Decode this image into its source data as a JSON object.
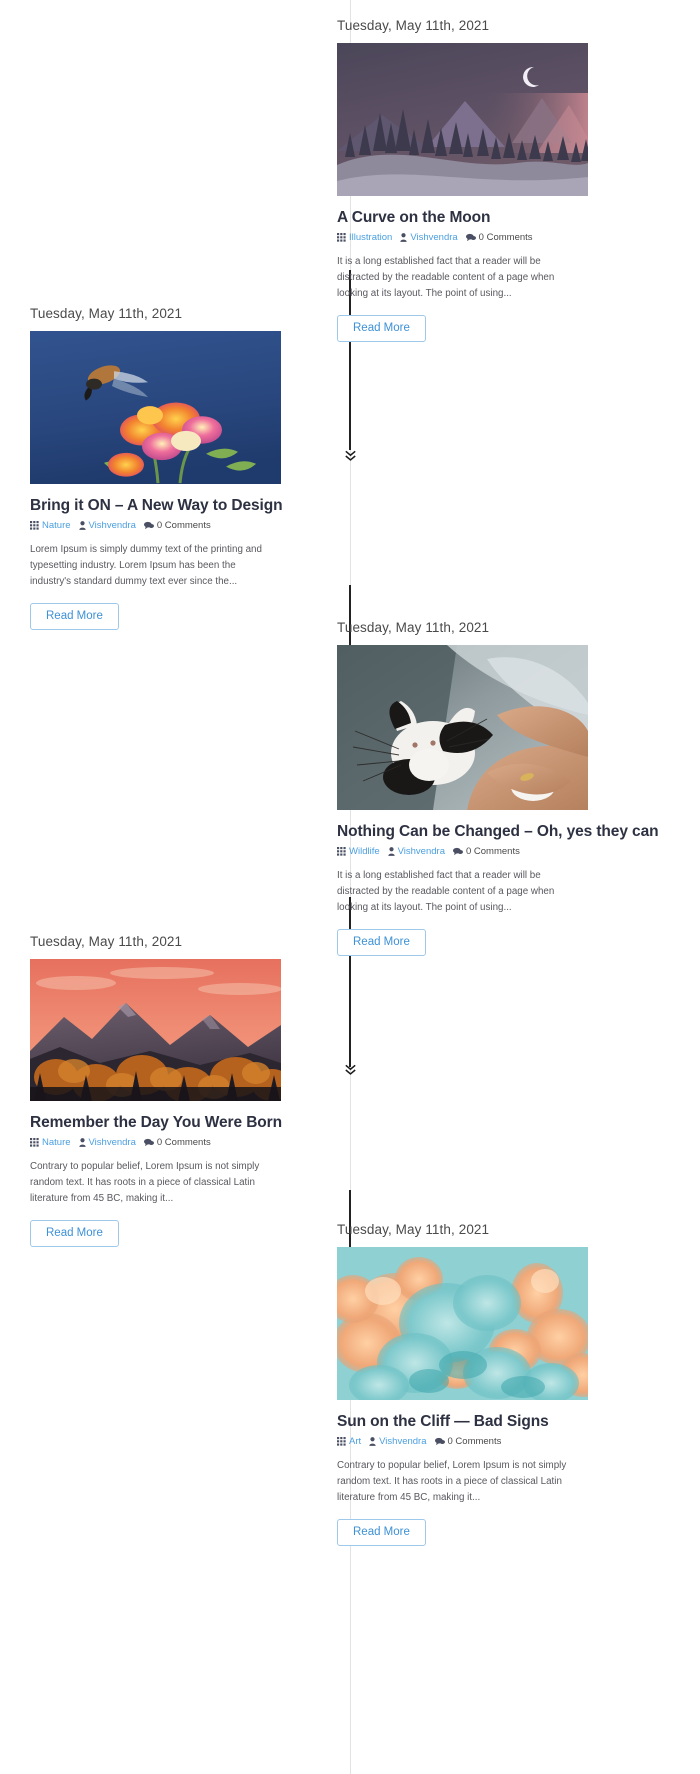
{
  "layout": {
    "type": "blog-timeline",
    "columns": 2,
    "spine_color": "#e2e2e2",
    "accent_color": "#3d91d6",
    "title_color": "#2d3142",
    "text_color": "#58585f"
  },
  "labels": {
    "read_more": "Read More",
    "comments_suffix": "Comments"
  },
  "icons": {
    "category": "grid-icon",
    "author": "user-icon",
    "comments": "comment-bubble-icon",
    "marker": "chevron-double-down-icon"
  },
  "posts": [
    {
      "id": "post-1",
      "side": "right",
      "date": "Tuesday, May 11th, 2021",
      "title": "A Curve on the Moon",
      "category": "Illustration",
      "author": "Vishvendra",
      "comments": "0 Comments",
      "excerpt": "It is a long established fact that a reader will be distracted by the readable content of a page when looking at its layout. The point of using...",
      "read_more": "Read More",
      "image_alt": "night-mountains-moon-illustration"
    },
    {
      "id": "post-2",
      "side": "left",
      "date": "Tuesday, May 11th, 2021",
      "title": "Bring it ON – A New Way to Design",
      "category": "Nature",
      "author": "Vishvendra",
      "comments": "0 Comments",
      "excerpt": "Lorem Ipsum is simply dummy text of the printing and typesetting industry. Lorem Ipsum has been the industry's standard dummy text ever since the...",
      "read_more": "Read More",
      "image_alt": "hummingbird-moth-on-lantana-flowers"
    },
    {
      "id": "post-3",
      "side": "right",
      "date": "Tuesday, May 11th, 2021",
      "title": "Nothing Can be Changed – Oh, yes they can",
      "category": "Wildlife",
      "author": "Vishvendra",
      "comments": "0 Comments",
      "excerpt": "It is a long established fact that a reader will be distracted by the readable content of a page when looking at its layout. The point of using...",
      "read_more": "Read More",
      "image_alt": "person-holding-black-and-white-cat"
    },
    {
      "id": "post-4",
      "side": "left",
      "date": "Tuesday, May 11th, 2021",
      "title": "Remember the Day You Were Born",
      "category": "Nature",
      "author": "Vishvendra",
      "comments": "0 Comments",
      "excerpt": "Contrary to popular belief, Lorem Ipsum is not simply random text. It has roots in a piece of classical Latin literature from 45 BC, making it...",
      "read_more": "Read More",
      "image_alt": "pink-sunset-over-mountain-and-autumn-forest"
    },
    {
      "id": "post-5",
      "side": "right",
      "date": "Tuesday, May 11th, 2021",
      "title": "Sun on the Cliff — Bad Signs",
      "category": "Art",
      "author": "Vishvendra",
      "comments": "0 Comments",
      "excerpt": "Contrary to popular belief, Lorem Ipsum is not simply random text. It has roots in a piece of classical Latin literature from 45 BC, making it...",
      "read_more": "Read More",
      "image_alt": "teal-and-orange-ink-cloud-abstract"
    }
  ]
}
